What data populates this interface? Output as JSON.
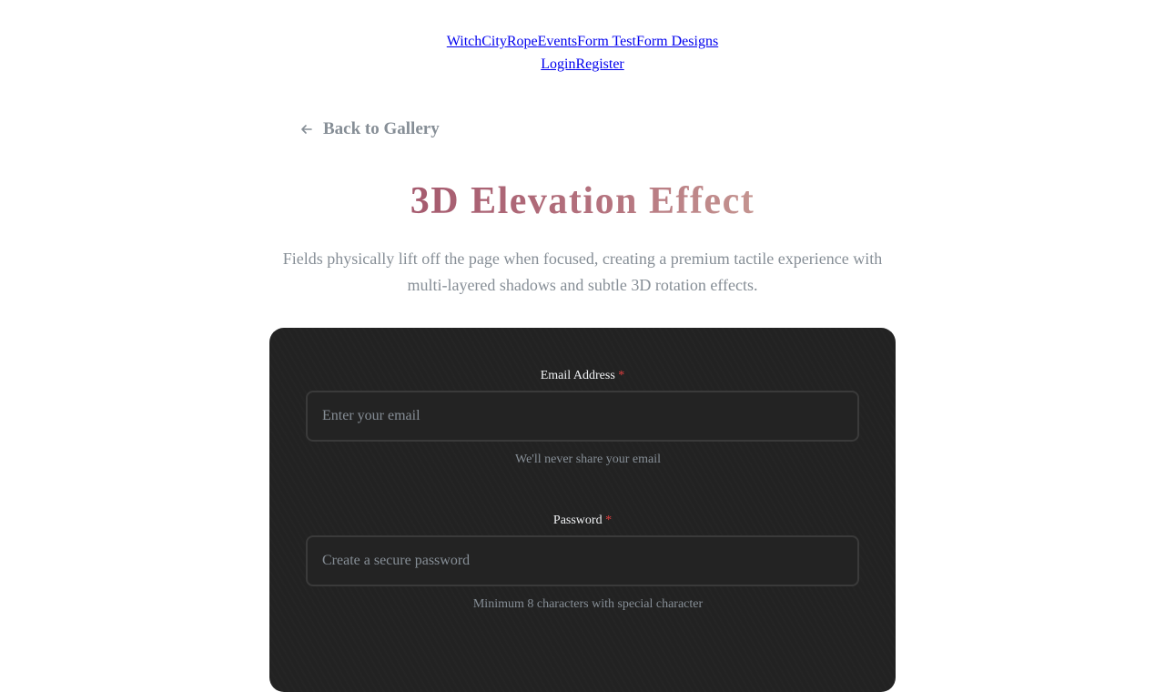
{
  "nav": {
    "row1": [
      "WitchCityRope",
      "Events",
      "Form Test",
      "Form Designs"
    ],
    "row2": [
      "Login",
      "Register"
    ]
  },
  "back_link": {
    "label": "Back to Gallery",
    "icon": "arrow-left-icon"
  },
  "page": {
    "title": "3D Elevation Effect",
    "subtitle": "Fields physically lift off the page when focused, creating a premium tactile experience with multi-layered shadows and subtle 3D rotation effects."
  },
  "form": {
    "fields": [
      {
        "label": "Email Address",
        "required_mark": "*",
        "placeholder": "Enter your email",
        "value": "",
        "help": "We'll never share your email"
      },
      {
        "label": "Password",
        "required_mark": "*",
        "placeholder": "Create a secure password",
        "value": "",
        "help": "Minimum 8 characters with special character"
      }
    ]
  },
  "colors": {
    "link": "#0000ee",
    "muted": "#868e96",
    "card_bg": "#222222",
    "required": "#e03e3e",
    "title_gradient_start": "#a55a6e",
    "title_gradient_end": "#c49490"
  }
}
